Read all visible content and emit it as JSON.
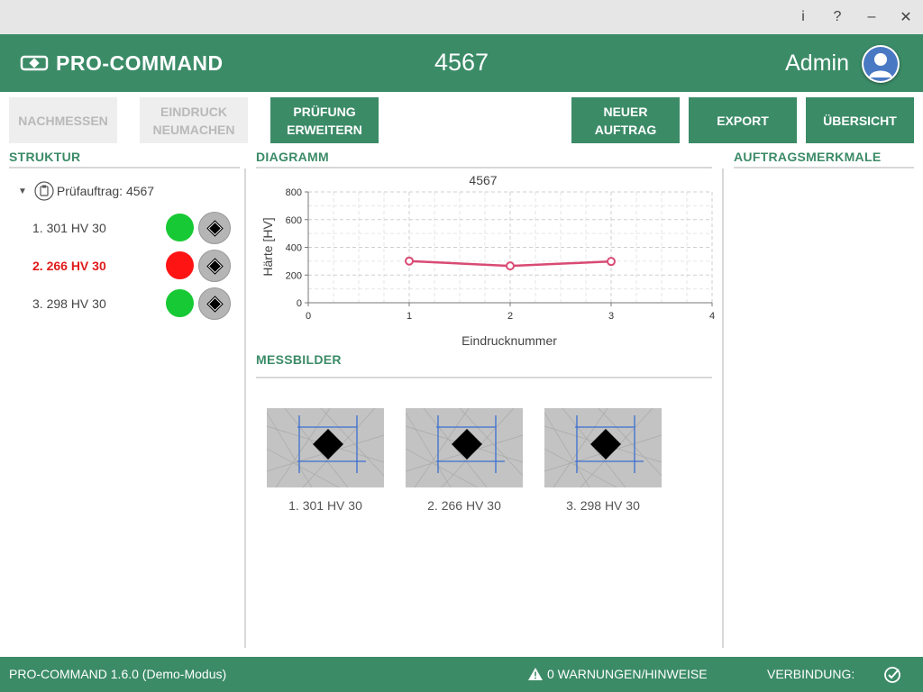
{
  "window": {
    "info_label": "i",
    "help_label": "?",
    "minimize_label": "–",
    "close_label": "✕"
  },
  "header": {
    "logo_text": "PRO-COMMAND",
    "order_number": "4567",
    "user_name": "Admin"
  },
  "toolbar": {
    "remeasure": "NACHMESSEN",
    "redo_indent": "EINDRUCK\nNEUMACHEN",
    "extend_test": "PRÜFUNG\nERWEITERN",
    "new_order": "NEUER\nAUFTRAG",
    "export": "EXPORT",
    "overview": "ÜBERSICHT"
  },
  "sections": {
    "structure": "STRUKTUR",
    "diagram": "DIAGRAMM",
    "order_features": "AUFTRAGSMERKMALE",
    "images": "MESSBILDER"
  },
  "tree": {
    "root_label": "Prüfauftrag: 4567",
    "items": [
      {
        "label": "1. 301 HV 30",
        "status": "ok"
      },
      {
        "label": "2. 266 HV 30",
        "status": "fail"
      },
      {
        "label": "3. 298 HV 30",
        "status": "ok"
      }
    ]
  },
  "colors": {
    "brand": "#3b8b67",
    "ok": "#17c934",
    "fail": "#ff1414",
    "series": "#d94a73"
  },
  "chart_data": {
    "type": "line",
    "title": "4567",
    "xlabel": "Eindrucknummer",
    "ylabel": "Härte [HV]",
    "xlim": [
      0,
      4
    ],
    "ylim": [
      0,
      800
    ],
    "xticks": [
      0,
      1,
      2,
      3,
      4
    ],
    "yticks": [
      0,
      200,
      400,
      600,
      800
    ],
    "grid": true,
    "series": [
      {
        "x": [
          1,
          2,
          3
        ],
        "y": [
          301,
          266,
          298
        ]
      }
    ]
  },
  "images": [
    {
      "label": "1. 301 HV 30"
    },
    {
      "label": "2. 266 HV 30"
    },
    {
      "label": "3. 298 HV 30"
    }
  ],
  "status": {
    "app_version": "PRO-COMMAND 1.6.0 (Demo-Modus)",
    "warnings": "0 WARNUNGEN/HINWEISE",
    "connection": "VERBINDUNG:"
  }
}
